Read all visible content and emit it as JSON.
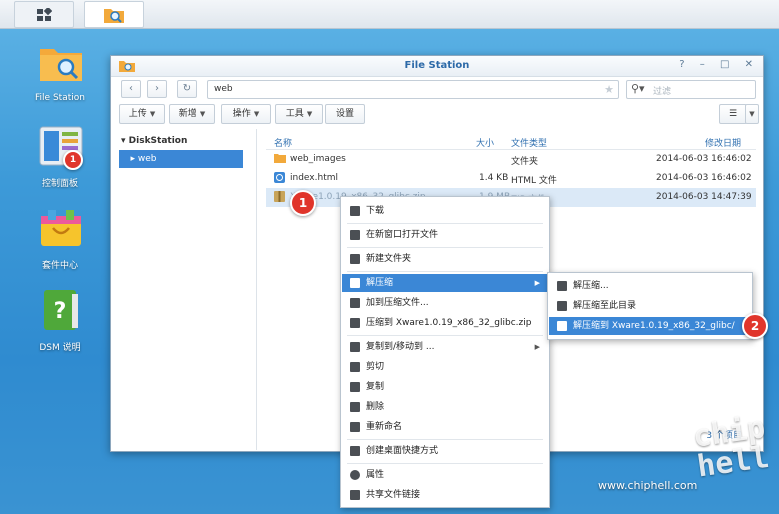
{
  "taskbar": {
    "main_menu_icon": "grid-icon",
    "active_app_icon": "file-station-icon"
  },
  "desktop_icons": [
    {
      "label": "File Station",
      "icon": "file-station-icon"
    },
    {
      "label": "控制面板",
      "icon": "control-panel-icon",
      "badge": "1"
    },
    {
      "label": "套件中心",
      "icon": "package-center-icon"
    },
    {
      "label": "DSM 说明",
      "icon": "help-icon"
    }
  ],
  "window": {
    "title": "File Station",
    "controls": [
      "?",
      "–",
      "□",
      "✕"
    ],
    "path": "web",
    "search_placeholder": "过滤",
    "toolbar": {
      "upload": "上传",
      "create": "新增",
      "action": "操作",
      "tools": "工具",
      "settings": "设置"
    },
    "sidebar": {
      "root": "DiskStation",
      "selected": "web"
    },
    "columns": {
      "name": "名称",
      "size": "大小",
      "type": "文件类型",
      "modified": "修改日期"
    },
    "rows": [
      {
        "name": "web_images",
        "size": "",
        "type": "文件夹",
        "modified": "2014-06-03 16:46:02"
      },
      {
        "name": "index.html",
        "size": "1.4 KB",
        "type": "HTML 文件",
        "modified": "2014-06-03 16:46:02"
      },
      {
        "name": "Xware1.0.19_x86_32_glibc.zip",
        "size": "1.9 MB",
        "type": "ZIP 文件",
        "modified": "2014-06-03 14:47:39"
      }
    ],
    "item_count": "3 个项目"
  },
  "context_menu": {
    "download": "下载",
    "open_new_window": "在新窗口打开文件",
    "new_folder": "新建文件夹",
    "extract": "解压缩",
    "add_to_archive": "加到压缩文件...",
    "compress_to": "压缩到 Xware1.0.19_x86_32_glibc.zip",
    "copy_move_to": "复制到/移动到 ...",
    "cut": "剪切",
    "copy": "复制",
    "delete": "删除",
    "rename": "重新命名",
    "create_shortcut": "创建桌面快捷方式",
    "properties": "属性",
    "share_link": "共享文件链接"
  },
  "submenu": {
    "extract_ellipsis": "解压缩...",
    "extract_here": "解压缩至此目录",
    "extract_to": "解压缩到 Xware1.0.19_x86_32_glibc/"
  },
  "callouts": [
    "1",
    "2"
  ],
  "watermark": "www.chiphell.com",
  "logo_text": "chip hell",
  "colors": {
    "accent": "#3b87d6",
    "badge": "#e0352b",
    "title": "#2d6aa8"
  }
}
